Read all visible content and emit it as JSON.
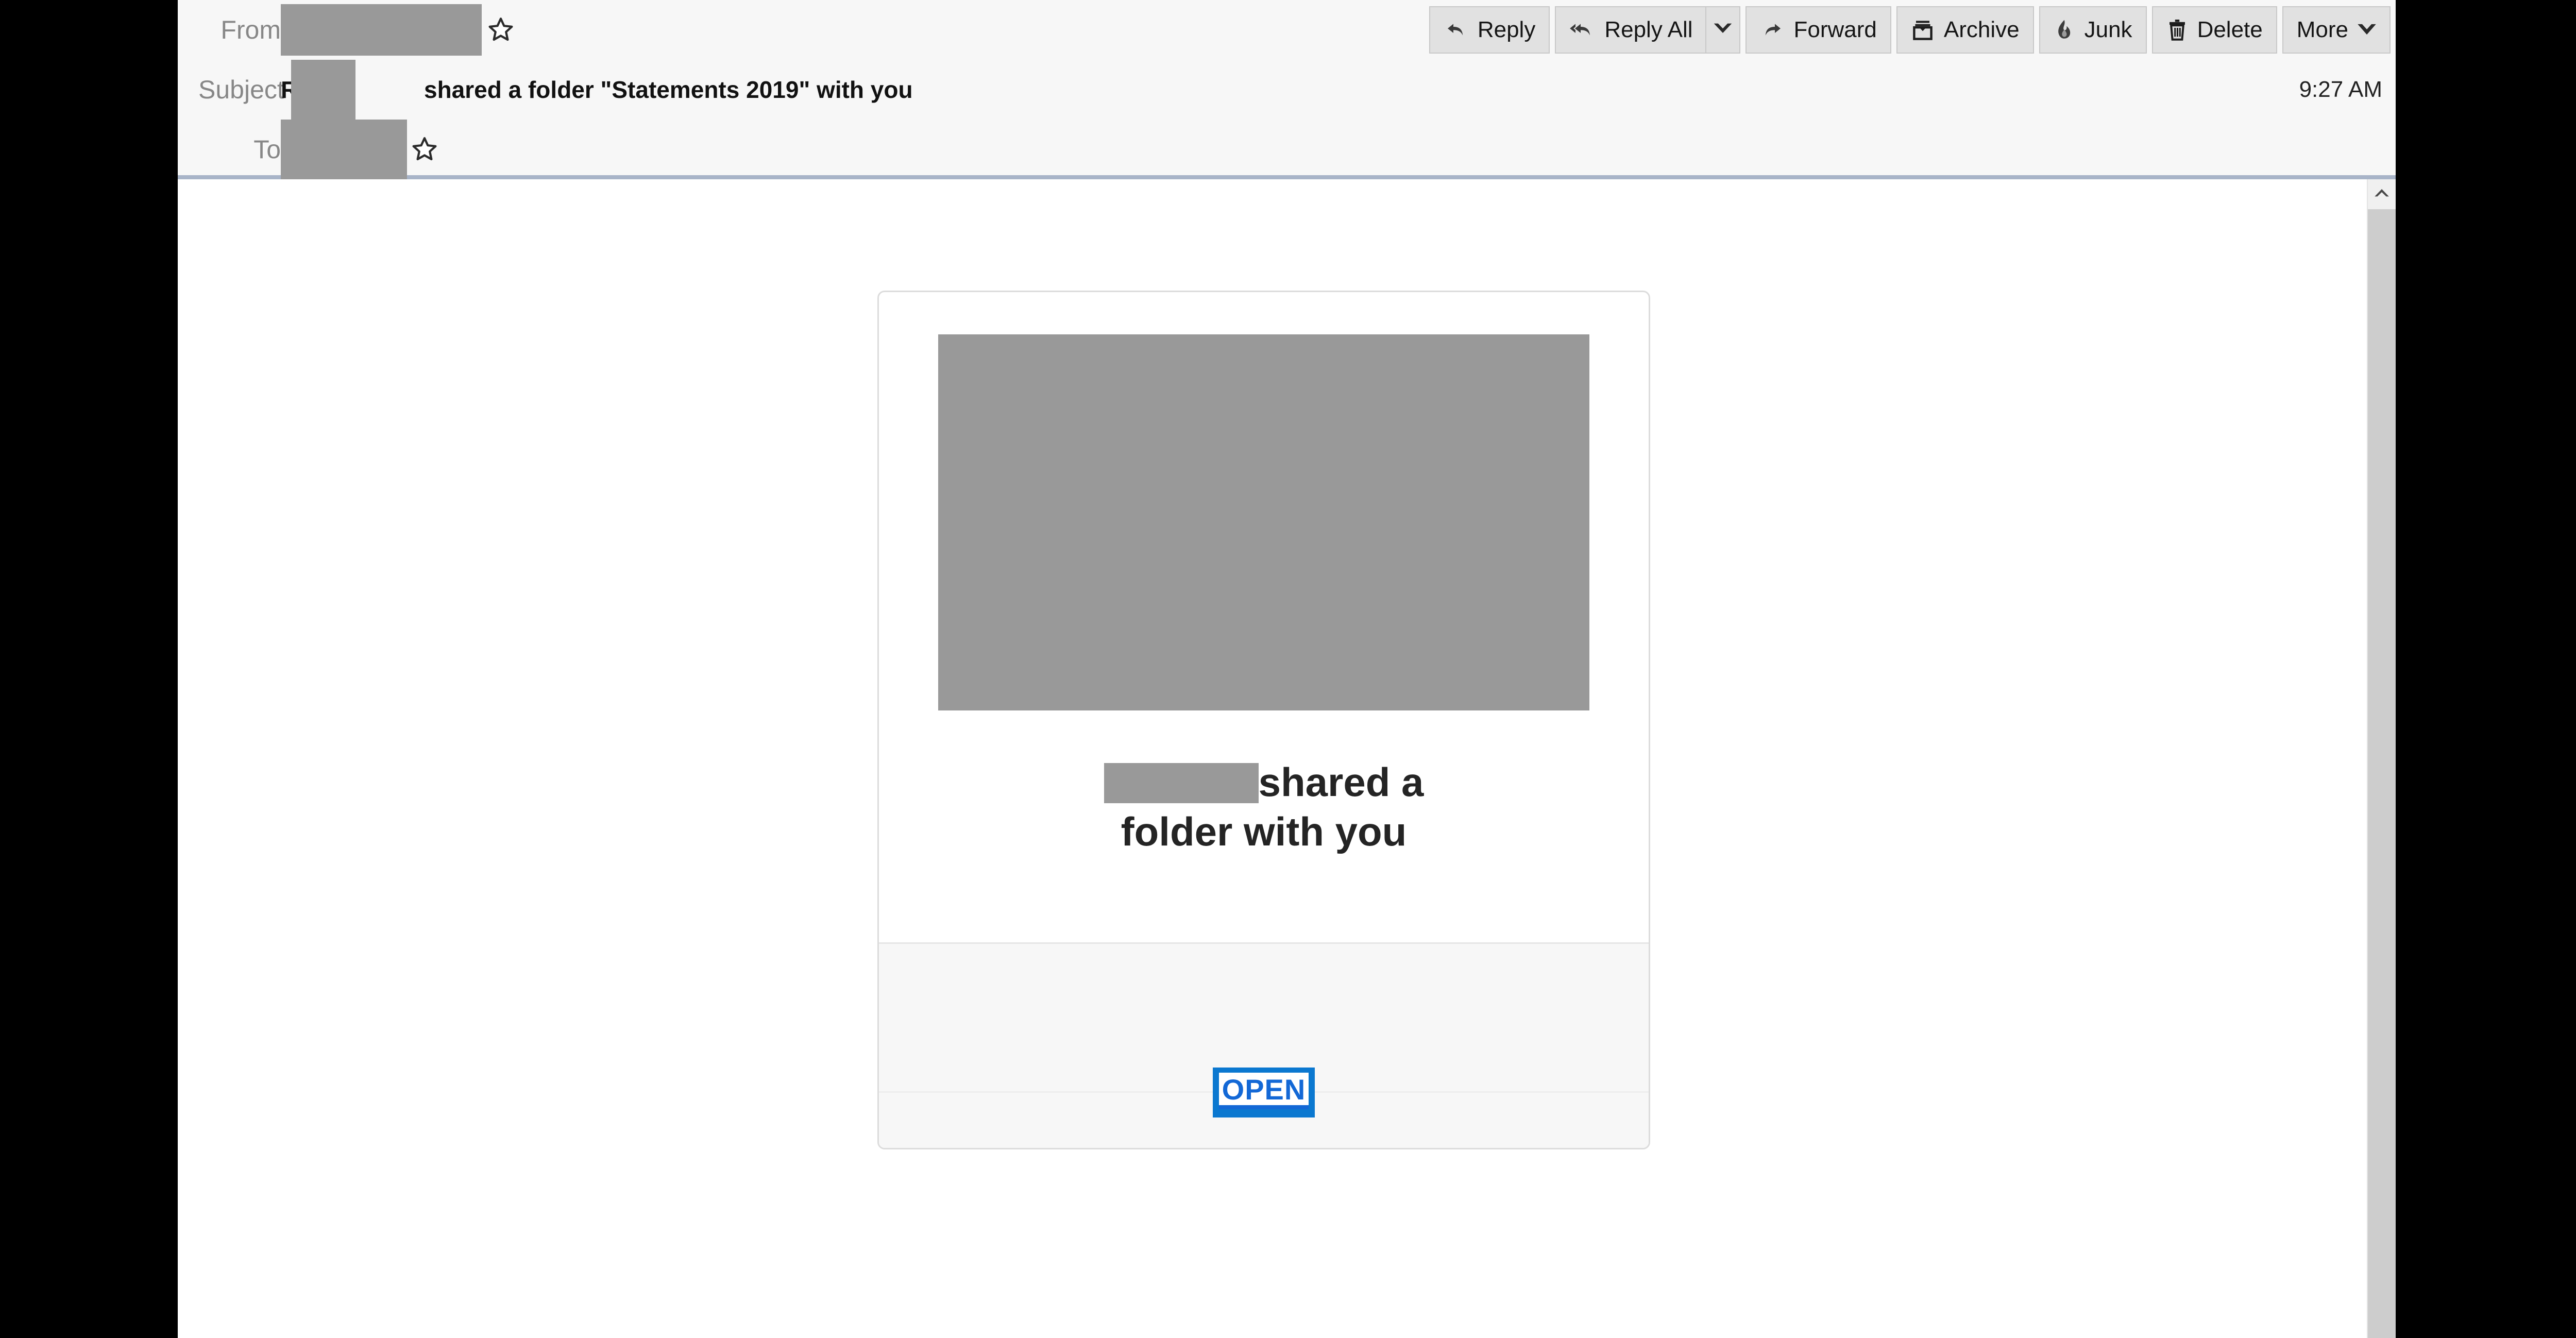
{
  "window": {
    "background_color": "#ffffff",
    "side_bar_color": "#000000"
  },
  "header": {
    "background_color": "#f7f7f7",
    "separator_color": "#a8b4c8",
    "rows": [
      {
        "label": "From",
        "value_redacted": true
      },
      {
        "label": "Subject",
        "value_redacted": true
      },
      {
        "label": "To",
        "value_redacted": true
      }
    ],
    "from": {
      "label": "From",
      "star_icon": "star-outline-icon"
    },
    "subject": {
      "label": "Subject",
      "prefix": "Re:",
      "text": "shared a folder \"Statements 2019\" with you",
      "full_text": "Re: shared a folder \"Statements 2019\" with you"
    },
    "to": {
      "label": "To",
      "star_icon": "star-outline-icon"
    },
    "timestamp": "9:27 AM"
  },
  "toolbar": {
    "buttons": [
      {
        "id": "reply",
        "label": "Reply",
        "icon": "reply-arrow-icon",
        "has_dropdown": false
      },
      {
        "id": "reply-all",
        "label": "Reply All",
        "icon": "reply-all-arrow-icon",
        "has_dropdown": true
      },
      {
        "id": "forward",
        "label": "Forward",
        "icon": "forward-arrow-icon",
        "has_dropdown": false
      },
      {
        "id": "archive",
        "label": "Archive",
        "icon": "archive-box-icon",
        "has_dropdown": false
      },
      {
        "id": "junk",
        "label": "Junk",
        "icon": "flame-icon",
        "has_dropdown": false
      },
      {
        "id": "delete",
        "label": "Delete",
        "icon": "trash-can-icon",
        "has_dropdown": false
      },
      {
        "id": "more",
        "label": "More",
        "icon": "chevron-down-icon",
        "has_dropdown": true
      }
    ],
    "button_face_color": "#e1e1e1",
    "button_border_color": "#c8c8c8"
  },
  "message_body": {
    "card": {
      "hero_image": {
        "alt": "redacted-banner-image",
        "color": "#999999"
      },
      "headline_redacted_name": true,
      "headline_line1_suffix": "shared a",
      "headline_line2": "folder with you",
      "headline_full": "shared a folder with you",
      "divider_color": "#e6e6e6",
      "lower_panel_color": "#f7f7f7",
      "cta": {
        "label": "OPEN",
        "highlight_color": "#0b78d0",
        "link_color": "#1368d6",
        "selected": true
      }
    }
  },
  "scrollbar": {
    "up_arrow_icon": "chevron-up-icon",
    "track_color": "#f0f0f0",
    "thumb_color": "#cdcdcd"
  }
}
